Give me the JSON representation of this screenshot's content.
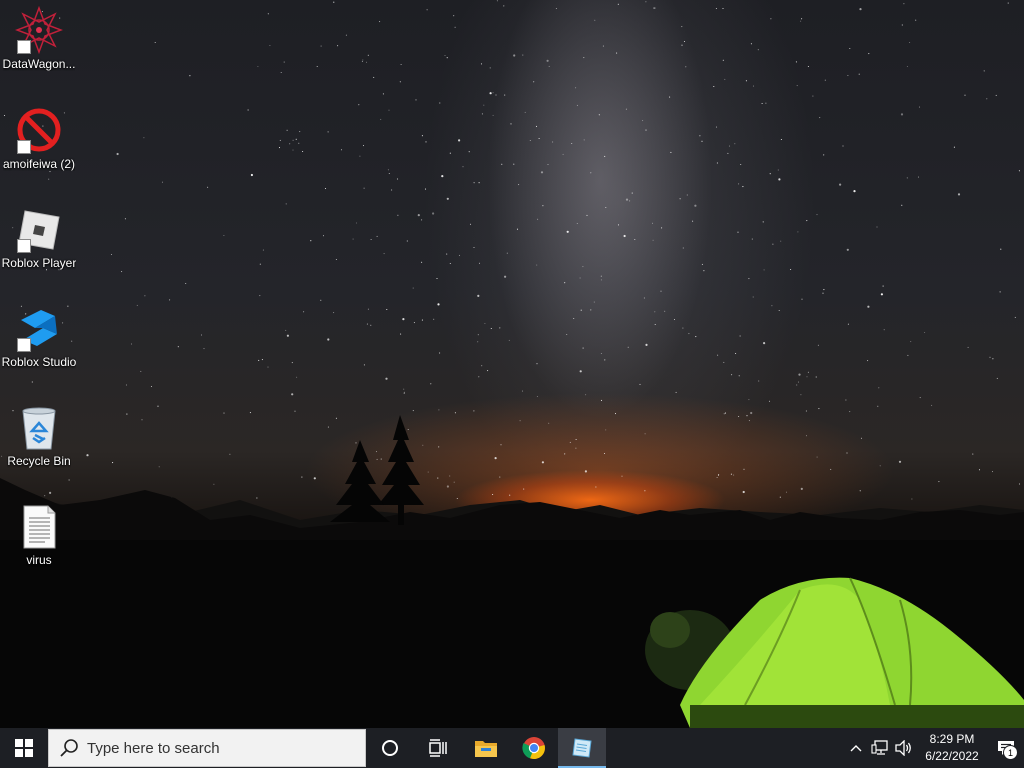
{
  "desktop": {
    "icons": [
      {
        "label": "DataWagon...",
        "icon": "mandala-icon",
        "shortcut": true
      },
      {
        "label": "amoifeiwa (2)",
        "icon": "no-entry-icon",
        "shortcut": true
      },
      {
        "label": "Roblox Player",
        "icon": "roblox-player-icon",
        "shortcut": true
      },
      {
        "label": "Roblox Studio",
        "icon": "roblox-studio-icon",
        "shortcut": true
      },
      {
        "label": "Recycle Bin",
        "icon": "recycle-bin-icon",
        "shortcut": false
      },
      {
        "label": "virus",
        "icon": "text-document-icon",
        "shortcut": false
      }
    ]
  },
  "taskbar": {
    "search": {
      "placeholder": "Type here to search"
    },
    "pinned": [
      {
        "name": "cortana",
        "icon": "circle-icon"
      },
      {
        "name": "task-view",
        "icon": "task-view-icon"
      },
      {
        "name": "file-explorer",
        "icon": "folder-icon"
      },
      {
        "name": "chrome",
        "icon": "chrome-icon"
      },
      {
        "name": "notepad",
        "icon": "notepad-icon",
        "active": true
      }
    ],
    "tray": {
      "time": "8:29 PM",
      "date": "6/22/2022",
      "notification_count": "1"
    }
  },
  "colors": {
    "taskbar": "#1d1f24",
    "accent": "#76b9ed",
    "tent": "#8fd631"
  }
}
